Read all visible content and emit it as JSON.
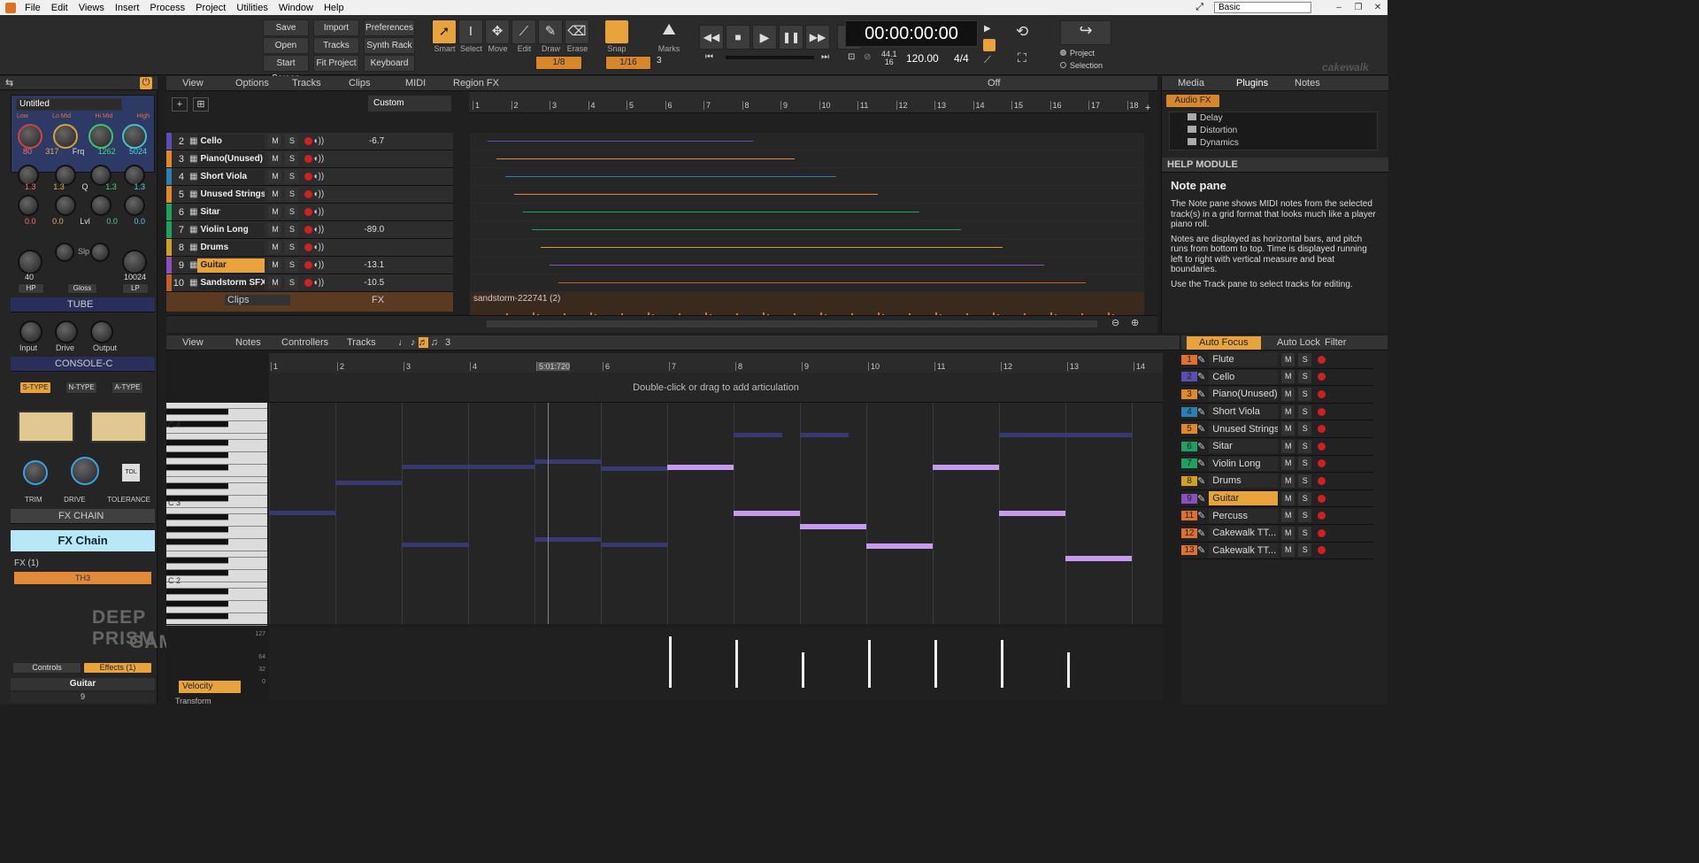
{
  "menu": [
    "File",
    "Edit",
    "Views",
    "Insert",
    "Process",
    "Project",
    "Utilities",
    "Window",
    "Help"
  ],
  "workspace": "Basic",
  "buttons": {
    "save": "Save",
    "import": "Import",
    "preferences": "Preferences",
    "open": "Open",
    "tracks": "Tracks",
    "synth_rack": "Synth Rack",
    "start_screen": "Start Screen",
    "fit_project": "Fit Project",
    "keyboard": "Keyboard"
  },
  "tools": [
    {
      "label": "Smart",
      "icon": "pointer-icon"
    },
    {
      "label": "Select",
      "icon": "select-icon"
    },
    {
      "label": "Move",
      "icon": "move-icon"
    },
    {
      "label": "Edit",
      "icon": "edit-icon"
    },
    {
      "label": "Draw",
      "icon": "pencil-icon"
    },
    {
      "label": "Erase",
      "icon": "eraser-icon"
    }
  ],
  "snap": {
    "label": "Snap",
    "value1": "1/8",
    "value2": "1/16",
    "marks": "Marks",
    "marks_num": "3"
  },
  "transport": {
    "time": "00:00:00:00",
    "rate_top": "44.1",
    "rate_bot": "16",
    "tempo": "120.00",
    "meter": "4/4"
  },
  "radio": {
    "project": "Project",
    "selection": "Selection"
  },
  "brand": "cakewalk",
  "track_toolbar": {
    "view": "View",
    "options": "Options",
    "tracks": "Tracks",
    "clips": "Clips",
    "midi": "MIDI",
    "region_fx": "Region FX",
    "off": "Off",
    "custom": "Custom"
  },
  "ruler": [
    "1",
    "2",
    "3",
    "4",
    "5",
    "6",
    "7",
    "8",
    "9",
    "10",
    "11",
    "12",
    "13",
    "14",
    "15",
    "16",
    "17",
    "18"
  ],
  "tracks": [
    {
      "num": "2",
      "name": "Cello",
      "vol": "-6.7",
      "color": "#5a4fb0",
      "sel": false
    },
    {
      "num": "3",
      "name": "Piano(Unused)",
      "vol": "",
      "color": "#e0882a",
      "sel": false
    },
    {
      "num": "4",
      "name": "Short Viola",
      "vol": "",
      "color": "#2c7fb0",
      "sel": false
    },
    {
      "num": "5",
      "name": "Unused Strings",
      "vol": "",
      "color": "#e0882a",
      "sel": false
    },
    {
      "num": "6",
      "name": "Sitar",
      "vol": "",
      "color": "#20a060",
      "sel": false
    },
    {
      "num": "7",
      "name": "Violin Long",
      "vol": "-89.0",
      "color": "#20a060",
      "sel": false
    },
    {
      "num": "8",
      "name": "Drums",
      "vol": "",
      "color": "#d0a020",
      "sel": false
    },
    {
      "num": "9",
      "name": "Guitar",
      "vol": "-13.1",
      "color": "#8a50c0",
      "sel": true
    },
    {
      "num": "10",
      "name": "Sandstorm SFX",
      "vol": "-10.5",
      "color": "#c06028",
      "sel": false
    }
  ],
  "sfx_clip": {
    "label": "Clips",
    "fx": "FX",
    "clip_name": "sandstorm-222741 (2)"
  },
  "inspector": {
    "title": "Untitled",
    "eq_labels": [
      "Low",
      "Lo Mid",
      "Hi Mid",
      "High"
    ],
    "eq_freq": [
      "80",
      "317",
      "Frq",
      "1262",
      "5024"
    ],
    "eq_gain": [
      "1.3",
      "1.3",
      "Q",
      "1.3",
      "1.3"
    ],
    "eq_lvl": [
      "0.0",
      "0.0",
      "Lvl",
      "0.0",
      "0.0"
    ],
    "hp_val": "40",
    "lp_val": "10024",
    "hp": "HP",
    "gloss": "Gloss",
    "lp": "LP",
    "slp": "Slp",
    "tube": "TUBE",
    "tube_knobs": [
      "Input",
      "Drive",
      "Output"
    ],
    "console": "CONSOLE-C",
    "types": [
      "S-TYPE",
      "N-TYPE",
      "A-TYPE"
    ],
    "cons_knobs": [
      "TRIM",
      "DRIVE",
      "TOLERANCE"
    ],
    "fxchain_hdr": "FX CHAIN",
    "fxchain": "FX Chain",
    "fx_count": "FX (1)",
    "fx_item": "TH3",
    "controls": "Controls",
    "effects": "Effects (1)",
    "track_name": "Guitar",
    "track_num": "9",
    "watermark1": "DEEP PRISM",
    "watermark2": "GAMES"
  },
  "browser": {
    "tabs": [
      "Media",
      "Plugins",
      "Notes"
    ],
    "audio_fx": "Audio FX",
    "tree": [
      "Delay",
      "Distortion",
      "Dynamics"
    ]
  },
  "help": {
    "header": "HELP MODULE",
    "title": "Note pane",
    "p1": "The Note pane shows MIDI notes from the selected track(s) in a grid format that looks much like a player piano roll.",
    "p2": "Notes are displayed as horizontal bars, and pitch runs from bottom to top. Time is displayed running left to right with vertical measure and beat boundaries.",
    "p3": "Use the Track pane to select tracks for editing."
  },
  "piano_toolbar": {
    "view": "View",
    "notes": "Notes",
    "controllers": "Controllers",
    "tracks": "Tracks",
    "num": "3",
    "auto_focus": "Auto Focus",
    "auto_lock": "Auto Lock",
    "filter": "Filter"
  },
  "piano_ruler": [
    "1",
    "2",
    "3",
    "4",
    "5:01:720",
    "6",
    "7",
    "8",
    "9",
    "10",
    "11",
    "12",
    "13",
    "14"
  ],
  "articulation": "Double-click or drag to add articulation",
  "keys": [
    "C 4",
    "C 3",
    "C 2"
  ],
  "velocity": {
    "label": "Velocity",
    "transform": "Transform",
    "ticks": [
      "127",
      "64",
      "32",
      "0"
    ]
  },
  "pr_tracks": [
    {
      "num": "1",
      "name": "Flute",
      "color": "#e07030"
    },
    {
      "num": "2",
      "name": "Cello",
      "color": "#5a4fb0"
    },
    {
      "num": "3",
      "name": "Piano(Unused)",
      "color": "#e0882a"
    },
    {
      "num": "4",
      "name": "Short Viola",
      "color": "#2c7fb0"
    },
    {
      "num": "5",
      "name": "Unused Strings",
      "color": "#e0882a"
    },
    {
      "num": "6",
      "name": "Sitar",
      "color": "#20a060"
    },
    {
      "num": "7",
      "name": "Violin Long",
      "color": "#20a060"
    },
    {
      "num": "8",
      "name": "Drums",
      "color": "#d0a020"
    },
    {
      "num": "9",
      "name": "Guitar",
      "color": "#8a50c0",
      "sel": true
    },
    {
      "num": "11",
      "name": "Percuss",
      "color": "#e07030"
    },
    {
      "num": "12",
      "name": "Cakewalk TT...",
      "color": "#e07030"
    },
    {
      "num": "13",
      "name": "Cakewalk TT...",
      "color": "#e07030"
    }
  ]
}
